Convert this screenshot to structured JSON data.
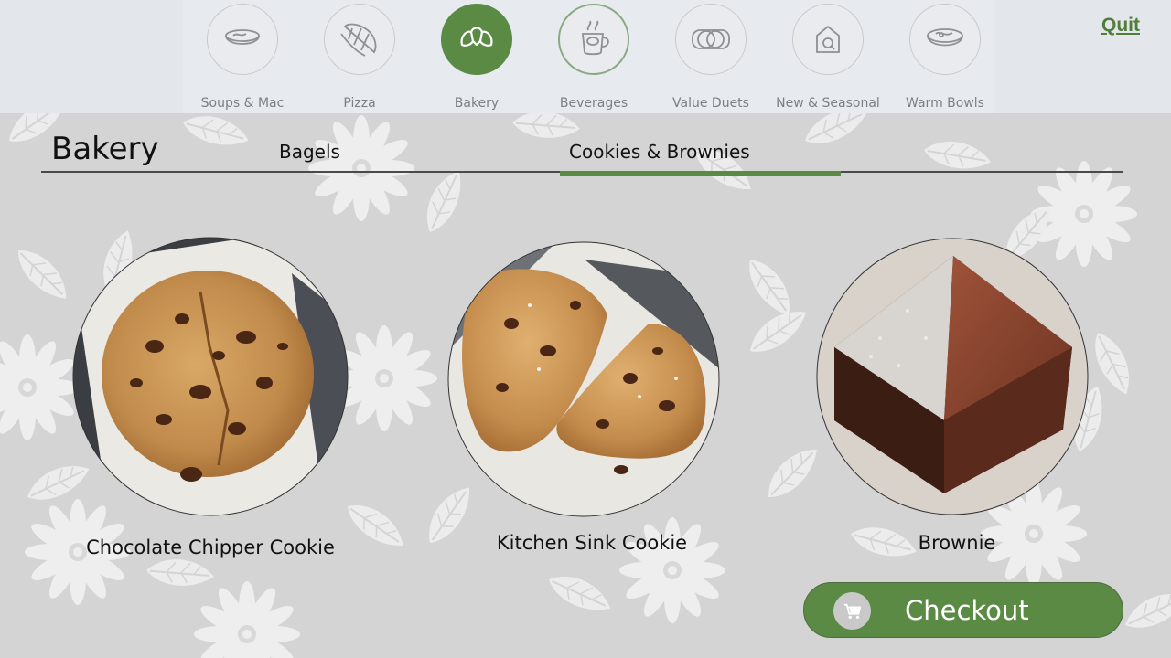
{
  "nav": {
    "categories": [
      {
        "label": "Soups & Mac",
        "icon": "soup-bowl-icon"
      },
      {
        "label": "Pizza",
        "icon": "pizza-icon"
      },
      {
        "label": "Bakery",
        "icon": "croissant-icon"
      },
      {
        "label": "Beverages",
        "icon": "coffee-cup-icon"
      },
      {
        "label": "Value Duets",
        "icon": "linked-rings-icon"
      },
      {
        "label": "New & Seasonal",
        "icon": "house-icon"
      },
      {
        "label": "Warm Bowls",
        "icon": "warm-bowl-icon"
      }
    ],
    "active": "Bakery",
    "quit_label": "Quit"
  },
  "header": {
    "title": "Bakery",
    "tabs": [
      {
        "label": "Bagels"
      },
      {
        "label": "Cookies & Brownies"
      }
    ],
    "active_tab": "Cookies & Brownies"
  },
  "products": [
    {
      "name": "Chocolate Chipper Cookie"
    },
    {
      "name": "Kitchen Sink Cookie"
    },
    {
      "name": "Brownie"
    }
  ],
  "checkout": {
    "label": "Checkout",
    "icon": "cart-icon"
  },
  "colors": {
    "accent": "#5a8a44",
    "background": "#d4d4d4",
    "nav_background": "#e7eaee"
  }
}
